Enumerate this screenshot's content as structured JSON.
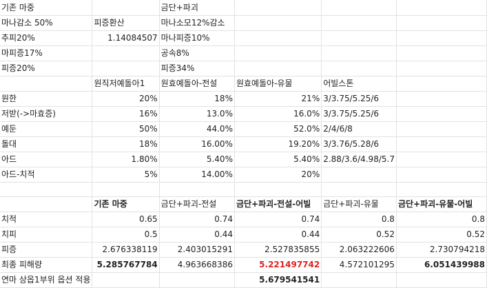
{
  "rows": [
    [
      "기존 마중",
      "",
      "금단+파괴",
      "",
      "",
      ""
    ],
    [
      "마나감소 50%",
      "피증환산",
      "마나소모12%감소",
      "",
      "",
      ""
    ],
    [
      "추피20%",
      "1.14084507",
      "마나피증10%",
      "",
      "",
      ""
    ],
    [
      "마피증17%",
      "",
      "공속8%",
      "",
      "",
      ""
    ],
    [
      "피증20%",
      "",
      "피증34%",
      "",
      "",
      ""
    ],
    [
      "",
      "원직저예돌아1",
      "원효예돌아-전설",
      "원효예돌아-유물",
      "어빌스톤",
      ""
    ],
    [
      "원한",
      "20%",
      "18%",
      "21%",
      "3/3.75/5.25/6",
      ""
    ],
    [
      "저받(->마효증)",
      "16%",
      "13.0%",
      "16.0%",
      "3/3.75/5.25/6",
      ""
    ],
    [
      "예둔",
      "50%",
      "44.0%",
      "52.0%",
      "2/4/6/8",
      ""
    ],
    [
      "돌대",
      "18%",
      "16.00%",
      "19.20%",
      "3/3.76/5.28/6",
      ""
    ],
    [
      "아드",
      "1.80%",
      "5.40%",
      "5.40%",
      "2.88/3.6/4.98/5.7",
      ""
    ],
    [
      "아드-치적",
      "5%",
      "14.00%",
      "20%",
      "",
      ""
    ],
    [
      "",
      "",
      "",
      "",
      "",
      ""
    ],
    [
      "",
      "기존 마중",
      "금단+파괴-전설",
      "금단+파괴-전설-어빌",
      "금단+파괴-유물",
      "금단+파괴-유물-어빌"
    ],
    [
      "치적",
      "0.65",
      "0.74",
      "0.74",
      "0.8",
      "0.8"
    ],
    [
      "치피",
      "0.5",
      "0.44",
      "0.44",
      "0.52",
      "0.52"
    ],
    [
      "피증",
      "2.676338119",
      "2.403015291",
      "2.527835855",
      "2.063222606",
      "2.730794218"
    ],
    [
      "최종 피해량",
      "5.285767784",
      "4.963668386",
      "5.221497742",
      "4.572101295",
      "6.051439988"
    ],
    [
      "연마 상옵1부위 옵션 적용",
      "",
      "",
      "5.679541541",
      "",
      ""
    ]
  ],
  "colors": {
    "grid_line": "#e2e2e2",
    "highlight_red": "#e0201f"
  }
}
